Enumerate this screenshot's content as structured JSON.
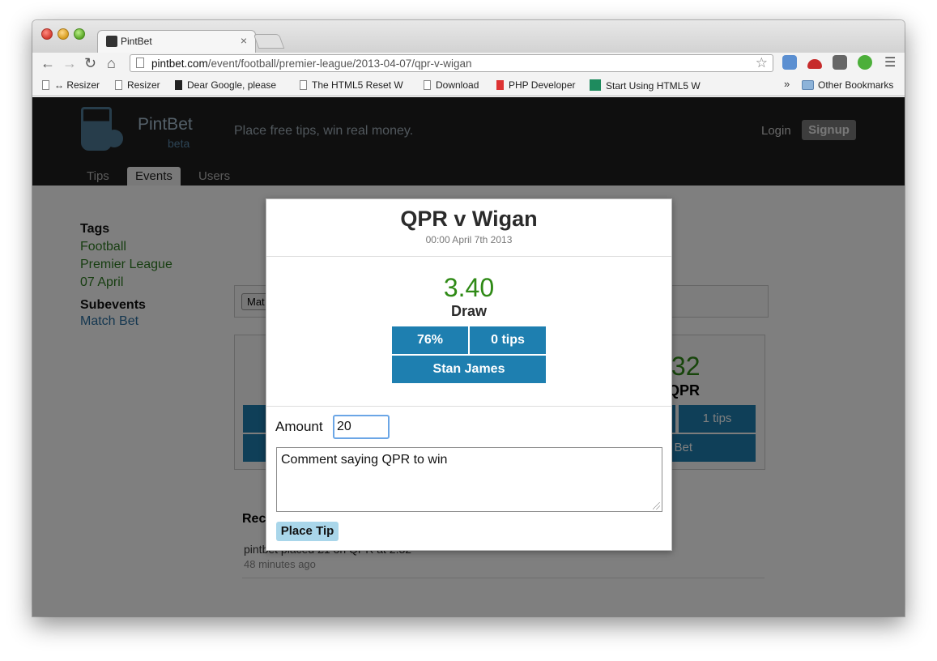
{
  "browser": {
    "tab_title": "PintBet",
    "url_host": "pintbet.com",
    "url_path": "/event/football/premier-league/2013-04-07/qpr-v-wigan",
    "bookmarks": [
      {
        "label": "↔ Resizer",
        "icon": "page-icon"
      },
      {
        "label": "Resizer",
        "icon": "page-icon"
      },
      {
        "label": "Dear Google, please",
        "icon": "info-icon"
      },
      {
        "label": "The HTML5 Reset W",
        "icon": "page-icon"
      },
      {
        "label": "Download",
        "icon": "page-icon"
      },
      {
        "label": "PHP Developer",
        "icon": "php-icon"
      },
      {
        "label": "Start Using HTML5 W",
        "icon": "plus-icon"
      }
    ],
    "bookmarks_overflow": "»",
    "other_bookmarks": "Other Bookmarks"
  },
  "site": {
    "name": "PintBet",
    "beta": "beta",
    "tagline": "Place free tips, win real money.",
    "login": "Login",
    "signup": "Signup",
    "tabs": [
      "Tips",
      "Events",
      "Users"
    ]
  },
  "sidebar": {
    "tags_heading": "Tags",
    "tags": [
      "Football",
      "Premier League",
      "07 April"
    ],
    "subevents_heading": "Subevents",
    "subevents": [
      "Match Bet"
    ]
  },
  "background": {
    "odds_partial": ".32",
    "team_partial": "QPR",
    "tips_partial": "1 tips",
    "bookie_partial": "y Bet",
    "filter_partial": "Mat",
    "recent_partial": "Rec",
    "activity_text": "pintbet placed £1 on QPR at 2.32",
    "activity_time": "48 minutes ago"
  },
  "modal": {
    "title": "QPR v Wigan",
    "datetime": "00:00 April 7th 2013",
    "odds": "3.40",
    "selection": "Draw",
    "percent": "76%",
    "tips": "0 tips",
    "bookmaker": "Stan James",
    "amount_label": "Amount",
    "amount_value": "20",
    "comment_value": "Comment saying QPR to win",
    "submit": "Place Tip"
  },
  "colors": {
    "header_bg": "#1f1f1f",
    "button_blue": "#1e7fb0",
    "odds_green": "#2f8a16",
    "place_tip_bg": "#a9d6ea"
  }
}
